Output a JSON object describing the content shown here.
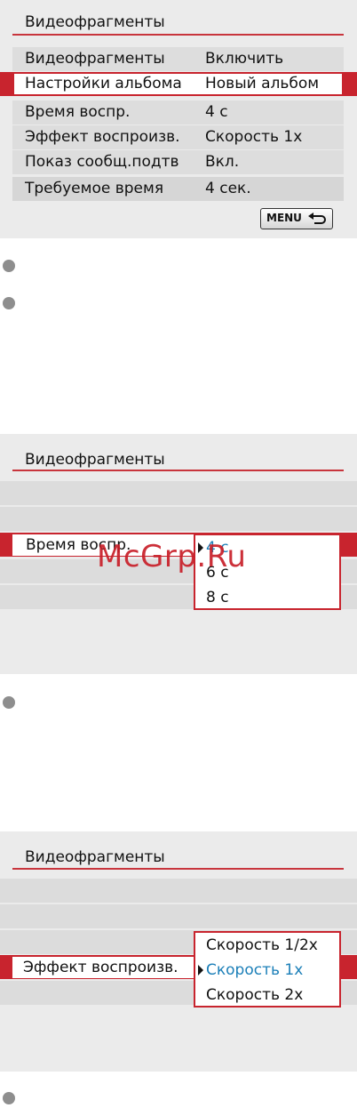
{
  "screen1": {
    "title": "Видеофрагменты",
    "rows": [
      {
        "label": "Видеофрагменты",
        "value": "Включить"
      },
      {
        "label": "Настройки альбома",
        "value": "Новый альбом"
      },
      {
        "label": "Время воспр.",
        "value": "4 с"
      },
      {
        "label": "Эффект воспроизв.",
        "value": "Скорость 1x"
      },
      {
        "label": "Показ сообщ.подтв",
        "value": "Вкл."
      },
      {
        "label": "Требуемое время",
        "value": "4 сек."
      }
    ],
    "menu_button": "MENU"
  },
  "screen2": {
    "title": "Видеофрагменты",
    "selected_label": "Время воспр.",
    "options": [
      "4 с",
      "6 с",
      "8 с"
    ],
    "current_option": "4 с"
  },
  "screen3": {
    "title": "Видеофрагменты",
    "selected_label": "Эффект воспроизв.",
    "options": [
      "Скорость 1/2x",
      "Скорость 1x",
      "Скорость 2x"
    ],
    "current_option": "Скорость 1x"
  },
  "watermark": "McGrp.Ru",
  "colors": {
    "accent": "#c8242e",
    "highlight": "#1b7fb8",
    "panel": "#ebebeb"
  }
}
